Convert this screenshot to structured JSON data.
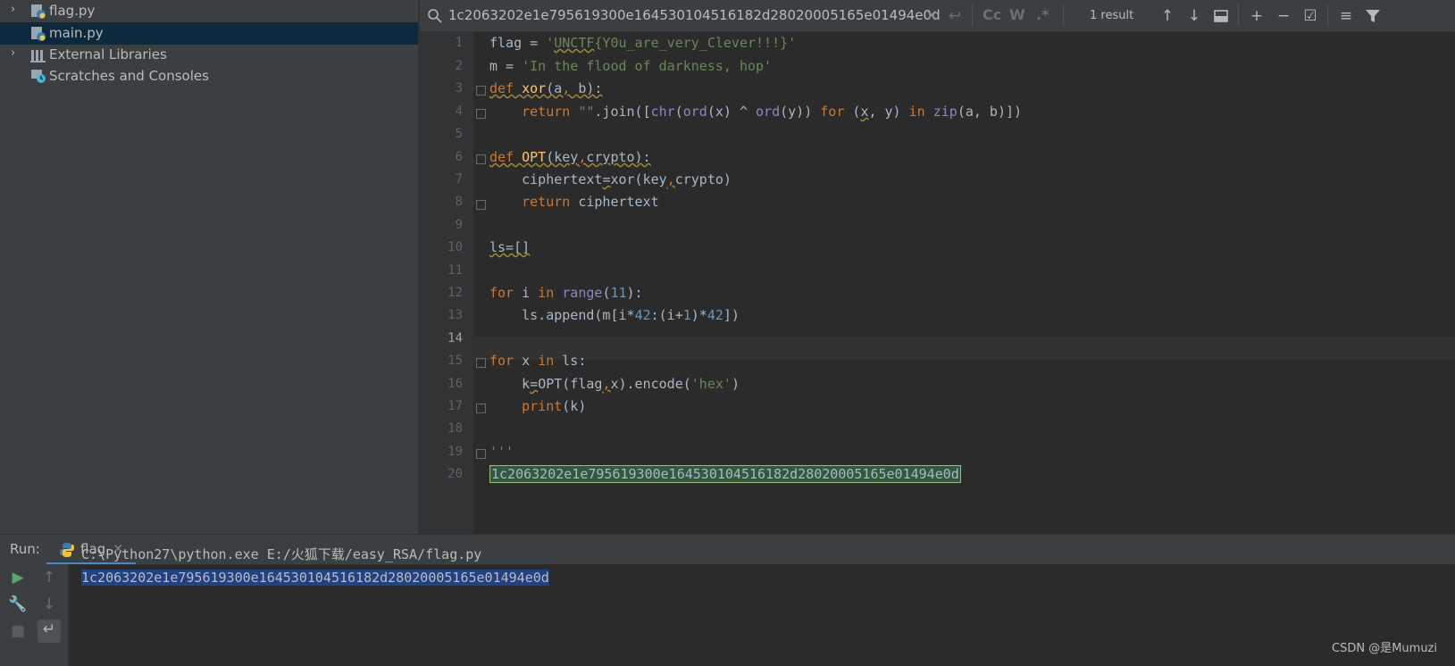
{
  "project_tree": {
    "items": [
      {
        "label": "flag.py",
        "expanded": false
      },
      {
        "label": "main.py",
        "selected": true
      },
      {
        "label": "External Libraries",
        "expanded": false
      },
      {
        "label": "Scratches and Consoles"
      }
    ]
  },
  "search": {
    "query": "1c2063202e1e795619300e164530104516182d28020005165e01494e0d",
    "match_case": "Cc",
    "words": "W",
    "regex": ".*",
    "result_count": "1 result"
  },
  "editor": {
    "line_numbers": [
      "1",
      "2",
      "3",
      "4",
      "5",
      "6",
      "7",
      "8",
      "9",
      "10",
      "11",
      "12",
      "13",
      "14",
      "15",
      "16",
      "17",
      "18",
      "19",
      "20"
    ],
    "current_line": "14",
    "code": {
      "l1_var": "flag",
      "l1_op": " = ",
      "l1_q1": "'",
      "l1_str": "UNCTF",
      "l1_str_rest": "{Y0u_are_very_Clever!!!}'",
      "l2_var": "m",
      "l2_op": " = ",
      "l2_str": "'In the flood of darkness, hop'",
      "l3_def": "def ",
      "l3_name": "xor",
      "l3_open": "(a",
      "l3_comma": ",",
      "l3_close": " b):",
      "l4_indent": "    ",
      "l4_return": "return ",
      "l4_s1": "\"\"",
      "l4_join": ".join([",
      "l4_chr": "chr",
      "l4_p1": "(",
      "l4_ord1": "ord",
      "l4_p2": "(x) ^ ",
      "l4_ord2": "ord",
      "l4_p3": "(y)) ",
      "l4_for": "for",
      "l4_p4": " (",
      "l4_x": "x",
      "l4_p5": ", y) ",
      "l4_in": "in",
      "l4_sp": " ",
      "l4_zip": "zip",
      "l4_p6": "(a, b)])",
      "l6_def": "def ",
      "l6_name": "OPT",
      "l6_open": "(key",
      "l6_comma": ",",
      "l6_close": "crypto):",
      "l7_indent": "    ",
      "l7_lhs": "ciphertext",
      "l7_eq": "=",
      "l7_call": "xor(key",
      "l7_comma": ",",
      "l7_rest": "crypto)",
      "l8_indent": "    ",
      "l8_return": "return ",
      "l8_rest": "ciphertext",
      "l10": "ls=[]",
      "l12_for": "for ",
      "l12_i": "i ",
      "l12_in": "in ",
      "l12_range": "range",
      "l12_p1": "(",
      "l12_n": "11",
      "l12_p2": "):",
      "l13_indent": "    ",
      "l13_a": "ls.append(m[i*",
      "l13_n1": "42",
      "l13_b": ":(i+",
      "l13_n2": "1",
      "l13_c": ")*",
      "l13_n3": "42",
      "l13_d": "])",
      "l15_for": "for ",
      "l15_x": "x ",
      "l15_in": "in ",
      "l15_ls": "ls:",
      "l16_indent": "    ",
      "l16_k": "k",
      "l16_eq": "=",
      "l16_call": "OPT(flag",
      "l16_comma": ",",
      "l16_rest": "x).encode(",
      "l16_str": "'hex'",
      "l16_end": ")",
      "l17_indent": "    ",
      "l17_print": "print",
      "l17_rest": "(k)",
      "l19": "'''",
      "l20": "1c2063202e1e795619300e164530104516182d28020005165e01494e0d"
    }
  },
  "run": {
    "label": "Run:",
    "tab": "flag",
    "console": [
      "C:\\Python27\\python.exe E:/火狐下载/easy_RSA/flag.py",
      "1c2063202e1e795619300e164530104516182d28020005165e01494e0d"
    ]
  },
  "watermark": "CSDN @是Mumuzi",
  "colors": {
    "accent": "#4a88c7",
    "selection": "#214283",
    "match": "#32593d"
  }
}
